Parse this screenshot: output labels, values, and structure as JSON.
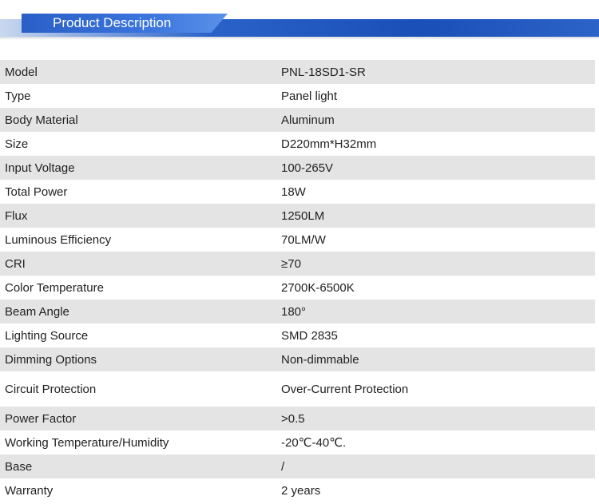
{
  "header": {
    "title": "Product Description"
  },
  "specs": [
    {
      "label": "Model",
      "value": "PNL-18SD1-SR"
    },
    {
      "label": "Type",
      "value": "Panel light"
    },
    {
      "label": "Body Material",
      "value": "Aluminum"
    },
    {
      "label": "Size",
      "value": "D220mm*H32mm"
    },
    {
      "label": "Input Voltage",
      "value": "100-265V"
    },
    {
      "label": "Total Power",
      "value": "18W"
    },
    {
      "label": "Flux",
      "value": "1250LM"
    },
    {
      "label": "Luminous Efficiency",
      "value": "70LM/W"
    },
    {
      "label": "CRI",
      "value": "≥70"
    },
    {
      "label": "Color Temperature",
      "value": "2700K-6500K"
    },
    {
      "label": "Beam Angle",
      "value": "180°"
    },
    {
      "label": "Lighting Source",
      "value": "SMD 2835"
    },
    {
      "label": "Dimming Options",
      "value": "Non-dimmable"
    },
    {
      "label": "Circuit Protection",
      "value": "Over-Current Protection"
    },
    {
      "label": "Power Factor",
      "value": ">0.5"
    },
    {
      "label": "Working Temperature/Humidity",
      "value": "-20℃-40℃."
    },
    {
      "label": "Base",
      "value": "/"
    },
    {
      "label": "Warranty",
      "value": "2 years"
    }
  ]
}
